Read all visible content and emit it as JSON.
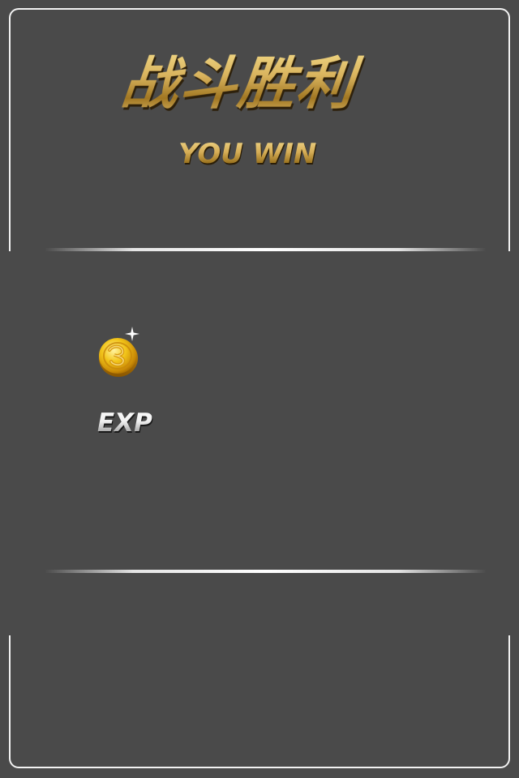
{
  "title": {
    "chinese": "战斗胜利",
    "english": "YOU WIN"
  },
  "rewards": {
    "coin_icon": "gold-coin-icon",
    "exp_label": "EXP"
  },
  "colors": {
    "background": "#4a4a4a",
    "frame": "#f2f2f2",
    "title_gold": "#c9a24a",
    "exp_silver": "#e6e6e6"
  }
}
